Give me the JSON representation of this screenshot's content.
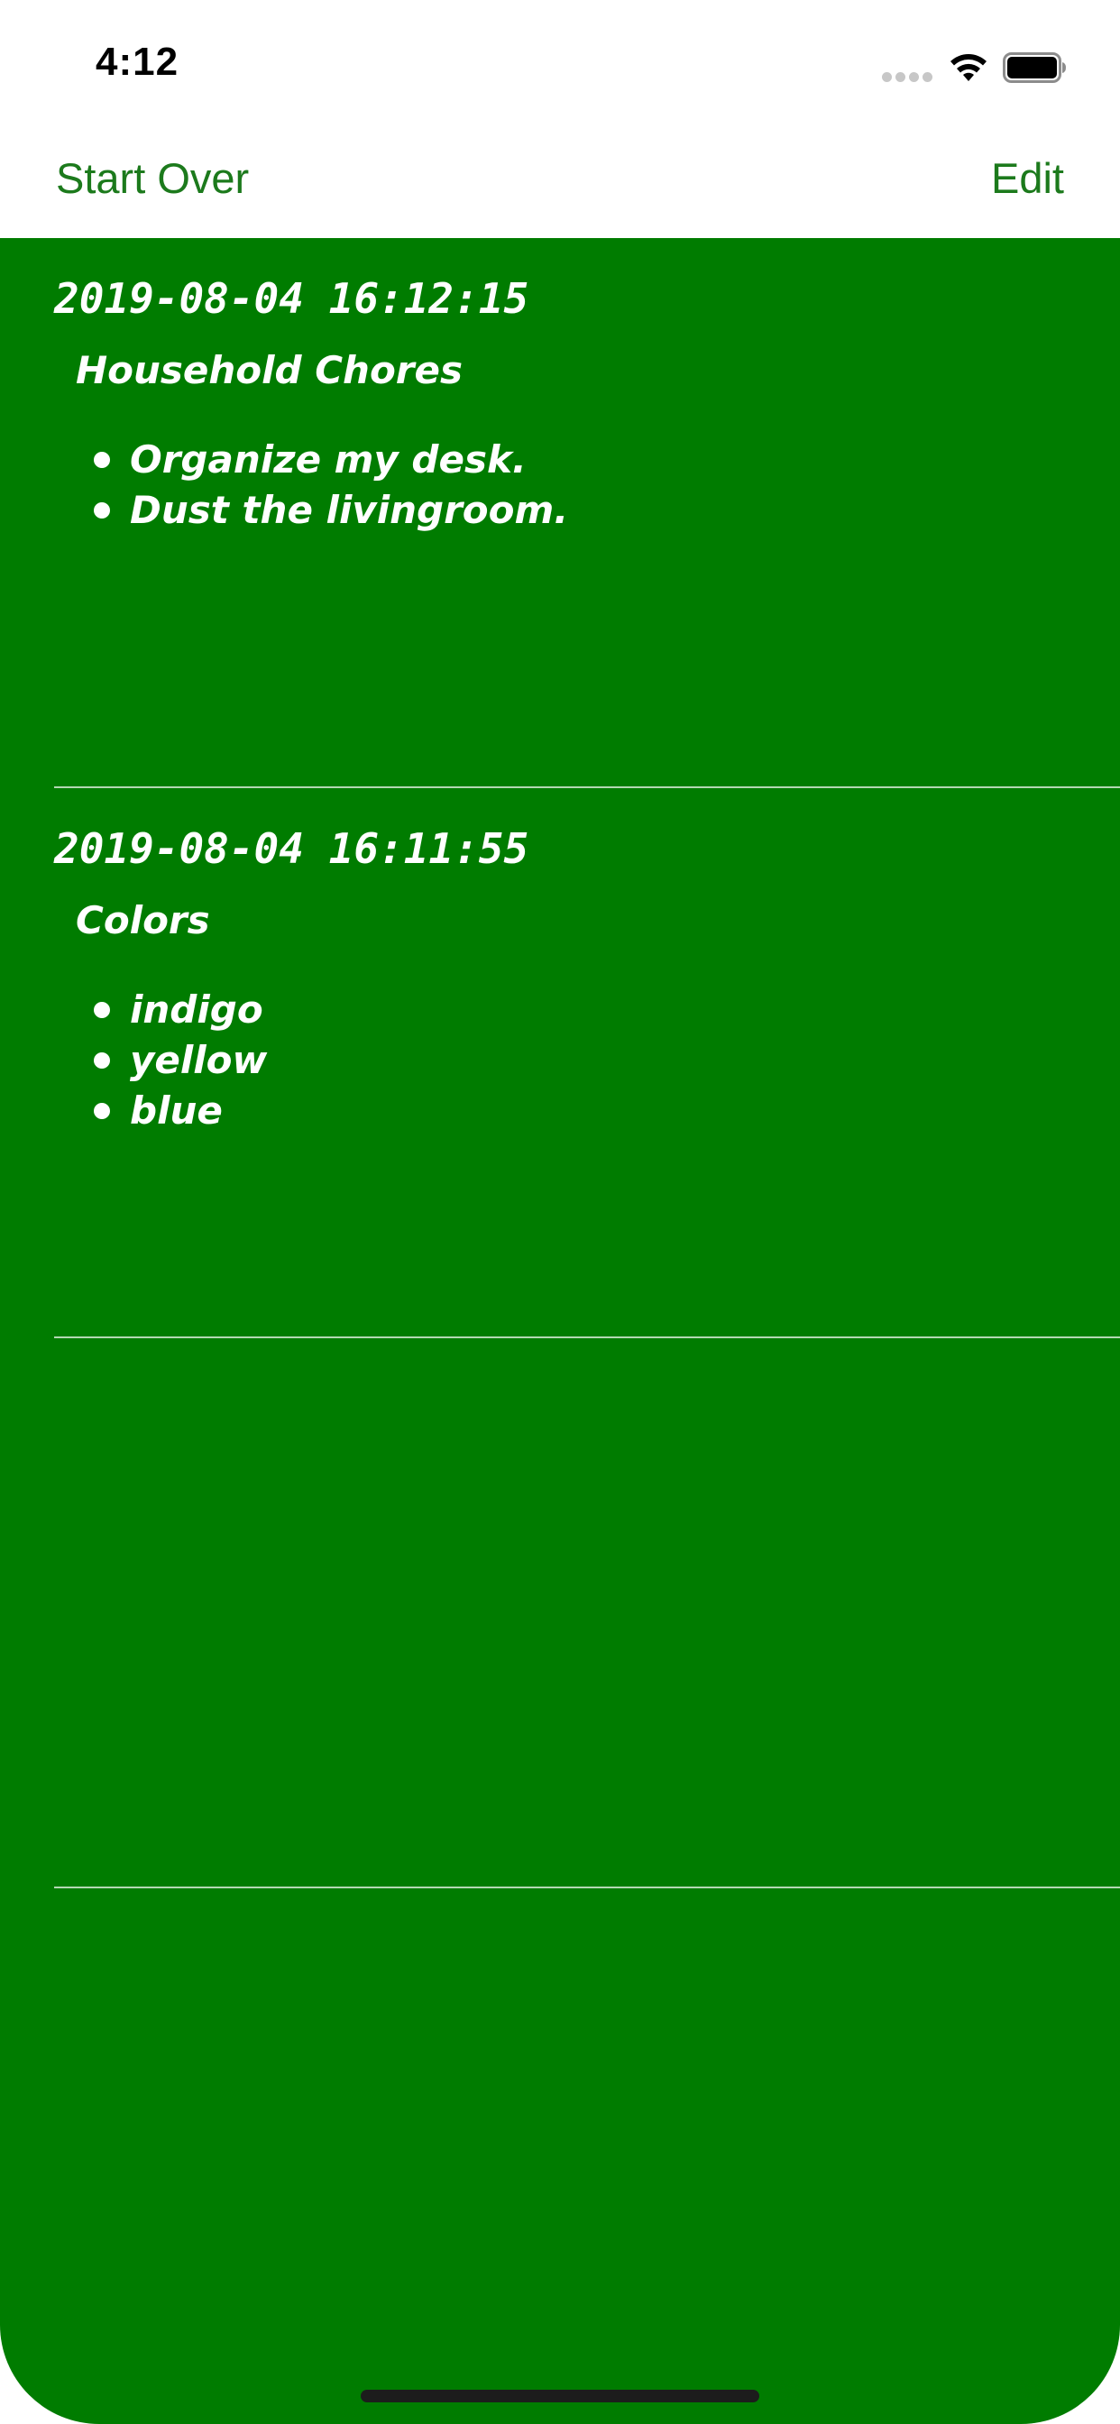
{
  "status_bar": {
    "time": "4:12",
    "icons": [
      "signal-dots-icon",
      "wifi-icon",
      "battery-icon"
    ]
  },
  "nav": {
    "left_button": "Start Over",
    "right_button": "Edit",
    "tint_color": "#1c7a1c"
  },
  "content": {
    "background_color": "#007c00",
    "text_color": "#ffffff",
    "notes": [
      {
        "date": "2019-08-04 16:12:15",
        "title": "Household Chores",
        "items": [
          "Organize my desk.",
          "Dust the livingroom."
        ]
      },
      {
        "date": "2019-08-04 16:11:55",
        "title": "Colors",
        "items": [
          "indigo",
          "yellow",
          "blue"
        ]
      }
    ]
  }
}
